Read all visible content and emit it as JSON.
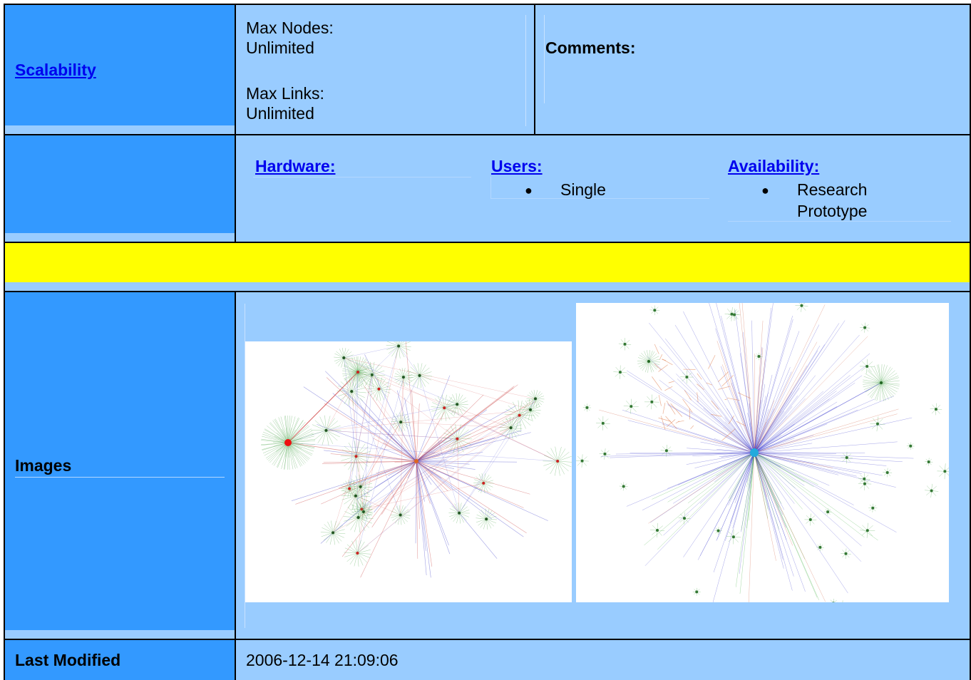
{
  "rows": {
    "scalability": {
      "label": "Scalability",
      "max_nodes_label": "Max Nodes:",
      "max_nodes_value": "Unlimited",
      "max_links_label": "Max Links:",
      "max_links_value": "Unlimited",
      "comments_label": "Comments:"
    },
    "platform": {
      "hardware_label": "Hardware:",
      "users_label": "Users:",
      "users_items": [
        "Single"
      ],
      "availability_label": "Availability:",
      "availability_items": [
        "Research Prototype"
      ],
      "availability_line1": "Research",
      "availability_line2": "Prototype"
    },
    "images": {
      "label": "Images",
      "image1_alt": "network graph visualization 1",
      "image2_alt": "network graph visualization 2"
    },
    "last_modified": {
      "label": "Last Modified",
      "value": "2006-12-14 21:09:06"
    }
  },
  "colors": {
    "label_cell": "#3399ff",
    "content_cell": "#99ccff",
    "separator_row": "#ffff00",
    "link": "#0000ee",
    "border": "#000000"
  }
}
